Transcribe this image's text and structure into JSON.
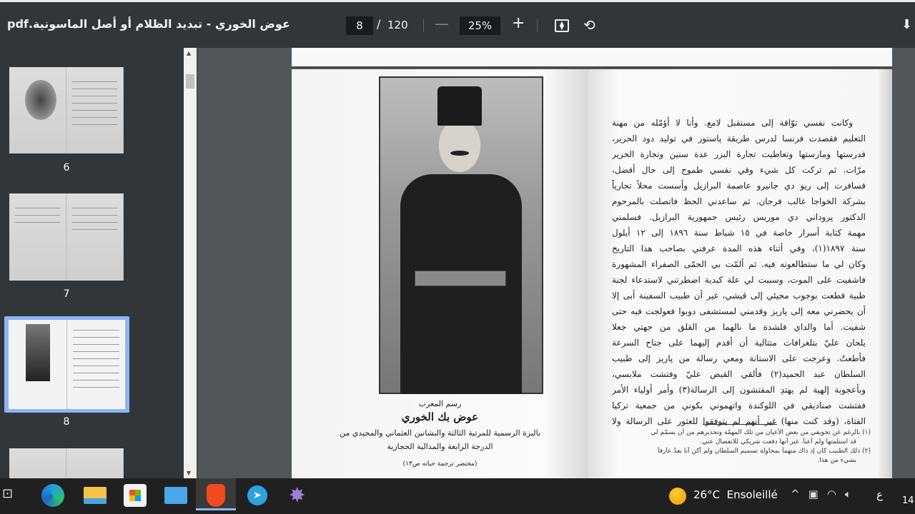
{
  "toolbar": {
    "title": "عوض الخوري - تبديد الظلام أو أصل الماسونية.pdf",
    "current_page": "8",
    "page_separator": "/",
    "total_pages": "120",
    "zoom_out": "—",
    "zoom_level": "25%",
    "zoom_in": "+",
    "fit_icon": "fit-to-page-icon",
    "rotate_icon": "rotate-icon",
    "download_icon": "download-icon"
  },
  "sidebar": {
    "thumbnails": [
      {
        "label": "6"
      },
      {
        "label": "7"
      },
      {
        "label": "8",
        "selected": true
      }
    ]
  },
  "left_page": {
    "caption_small": "رسم المعرب",
    "caption_name": "عوض بك الخوري",
    "caption_line1": "بالبزة الرسمية للمرتبة الثالثة والنشانين العثماني والمجيدي من",
    "caption_line2": "الدرجة الرابعة والمدالية الحجازية",
    "caption_ref": "(مختصر ترجمة حياته ص١٣)"
  },
  "right_page": {
    "lines": [
      "وكانت نفسي توّاقة إلى مستقبل لامع. وأنا لا أؤمّله من مهنة",
      "التعليم فقصدت فرنسا لدرس طريقة پاستور في توليد دود الحرير،",
      "فدرستها ومارستها وتعاطيت تجارة البزر عدة سنين وتجارة الحرير",
      "مرّات. ثم تركت كل شيء وفي نفسي طموح إلى حال أفضل،",
      "فسافرت إلى ريو دي جانيرو عاصمة البرازيل وأسست محلاً تجارياً",
      "بشركة الخواجا غالب فرجان. ثم ساعدني الحظ فاتصلت بالمرحوم",
      "الدكتور پروداني دي موريس رئيس جمهورية البرازيل. فسلمني",
      "مهمة كتابة أسرار خاصة في ١٥ شباط سنة ١٨٩٦ إلى ١٢ أيلول",
      "سنة ١٨٩٧(١)، وفي أثناء هذه المدة عرفني بصاحب هذا التاريخ",
      "وكان لي ما ستطالعونه فيه. ثم ألمّت بي الحمّى الصفراء المشهورة",
      "فاشفيت على الموت، وسببت لي علة كبدية اضطرتني لاستدعاء لجنة",
      "طبية قطعت بوجوب مجيئي إلى ڤيشي، غير أن طبيب السفينة أبى إلا",
      "أن يحضرني معه إلى پاريز وقدمني لمستشفى دوبوا فعولجت فيه حتى",
      "شفيت. أما والداي فلشدة ما نالهما من القلق من جهتي جعلا",
      "يلحان عليّ بتلغرافات متتالية أن أقدم إليهما على جناح السرعة",
      "فأطعتُ. وعرجت على الاستانة ومعي رسالة من پاريز إلى طبيب",
      "السلطان عبد الحميد(٢) فألقي القبض عليّ وفتشت ملابسي،",
      "وبأعجوبة إلهية لم يهتدِ المفتشون إلى الرسالة(٣) وأمر أولياء الأمر",
      "ففتشت صناديقي في اللوكندة واتهموني بكوني من جمعية تركيا",
      "الفتاة، (وقد كنت منها) غير أنهم لم يتوفقوا للعثور على الرسالة ولا"
    ],
    "footnotes": [
      "(١) بالرغم عن تخويفي من بعض الأعيان من تلك المهمّة وتحذيرهم من أن يسمّم لي",
      "قد استلمتها ولم أعبأ. غير أنها دفعت شريكي للانفصال عني.",
      "(٢) ذلك الطبيب كان إذ ذاك متهماً بمحاولة تسميم السلطان ولم أكن أنا بعدُ عارفاً",
      "بشيء من هذا."
    ]
  },
  "taskbar": {
    "apps": [
      "task-view",
      "edge",
      "file-explorer",
      "microsoft-store",
      "mail",
      "brave",
      "telegram",
      "app"
    ],
    "weather_temp": "26°C",
    "weather_desc": "Ensoleillé",
    "tray_chevron": "^",
    "language": "ع",
    "clock": "14:"
  }
}
